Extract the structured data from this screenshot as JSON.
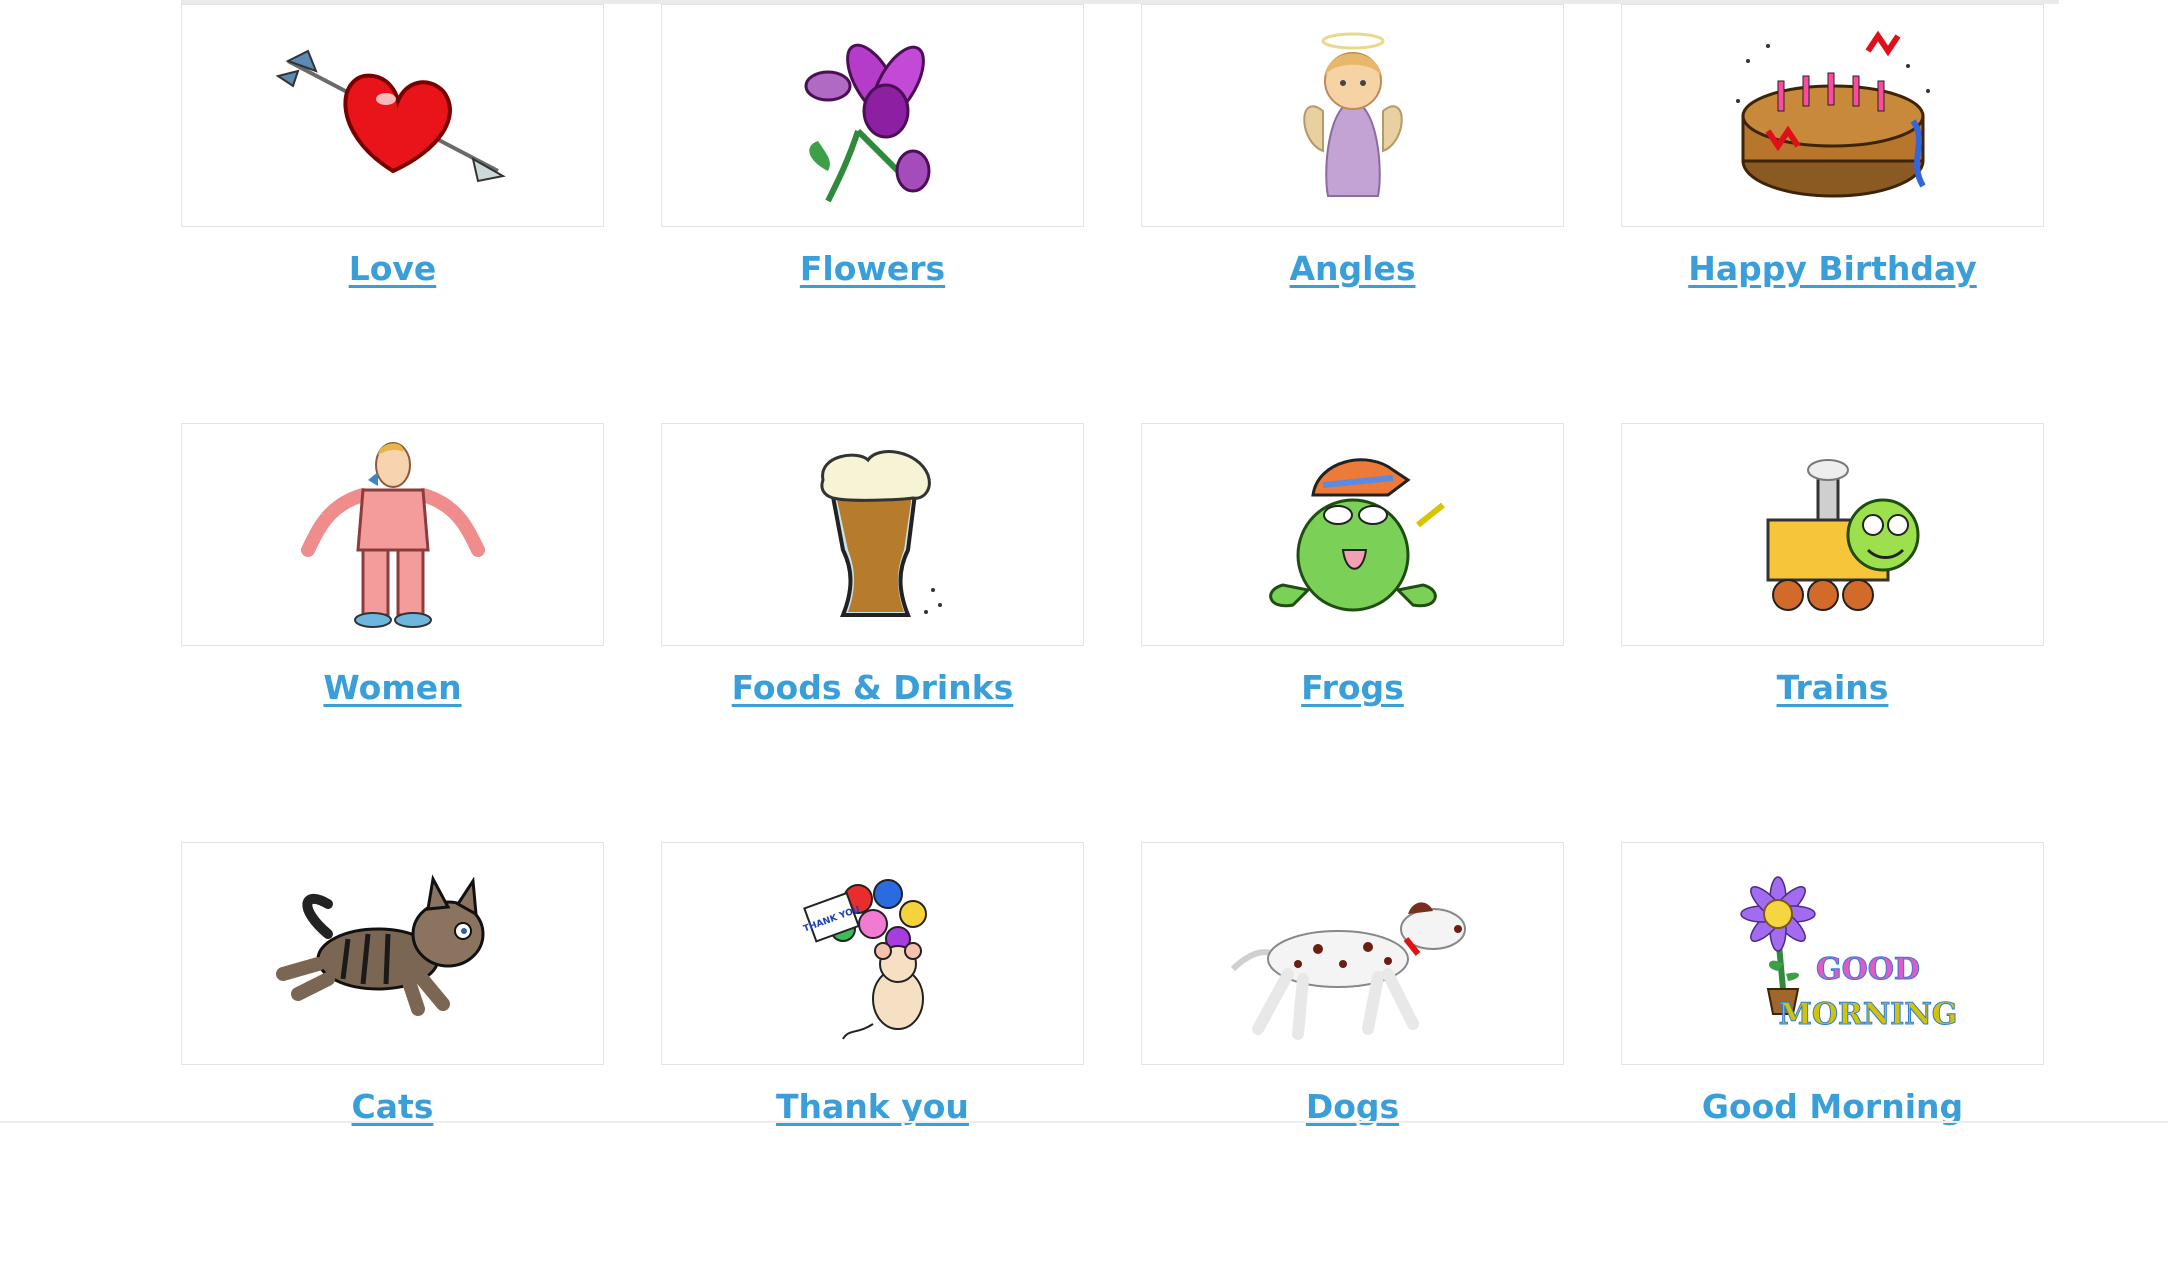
{
  "categories": [
    {
      "label": "Love",
      "icon": "heart-arrow-icon",
      "underlined": true
    },
    {
      "label": "Flowers",
      "icon": "orchid-flower-icon",
      "underlined": true
    },
    {
      "label": "Angles",
      "icon": "angel-icon",
      "underlined": true
    },
    {
      "label": "Happy Birthday",
      "icon": "birthday-cake-icon",
      "underlined": true
    },
    {
      "label": "Women",
      "icon": "woman-icon",
      "underlined": true
    },
    {
      "label": "Foods & Drinks",
      "icon": "beer-glass-icon",
      "underlined": true
    },
    {
      "label": "Frogs",
      "icon": "frog-icon",
      "underlined": true
    },
    {
      "label": "Trains",
      "icon": "train-icon",
      "underlined": true
    },
    {
      "label": "Cats",
      "icon": "cat-icon",
      "underlined": true
    },
    {
      "label": "Thank you",
      "icon": "thank-you-bouquet-icon",
      "underlined": true
    },
    {
      "label": "Dogs",
      "icon": "dalmatian-dog-icon",
      "underlined": true
    },
    {
      "label": "Good Morning",
      "icon": "good-morning-flower-icon",
      "underlined": false
    }
  ],
  "thumb_text": {
    "thank_you_sign": "THANK YOU",
    "good": "GOOD",
    "morning": "MORNING"
  },
  "colors": {
    "link": "#3a9fd8",
    "border": "#e3e3e3"
  }
}
